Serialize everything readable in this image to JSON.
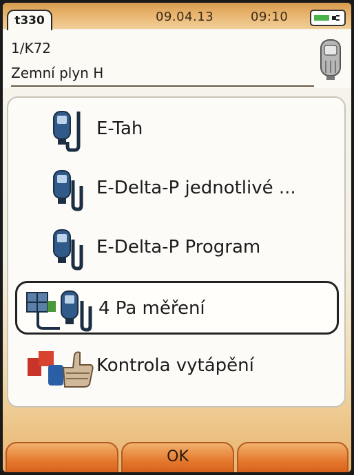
{
  "status": {
    "device_tab": "t330",
    "date": "09.04.13",
    "time": "09:10",
    "battery_icon": "battery-charging-icon"
  },
  "header": {
    "line1": "1/K72",
    "line2": "Zemní plyn H",
    "icon": "probe-icon"
  },
  "menu": {
    "items": [
      {
        "label": "E-Tah",
        "icon": "draught-probe-icon",
        "selected": false
      },
      {
        "label": "E-Delta-P jednotlivé ...",
        "icon": "delta-p-probe-icon",
        "selected": false
      },
      {
        "label": "E-Delta-P Program",
        "icon": "delta-p-program-icon",
        "selected": false
      },
      {
        "label": "4 Pa měření",
        "icon": "four-pa-measurement-icon",
        "selected": true
      },
      {
        "label": "Kontrola vytápění",
        "icon": "heating-check-thumbs-up-icon",
        "selected": false
      }
    ]
  },
  "softkeys": {
    "left": "",
    "center": "OK",
    "right": ""
  },
  "colors": {
    "accent_orange": "#e57a2e",
    "selection_border": "#222222",
    "battery_green": "#49b449"
  }
}
